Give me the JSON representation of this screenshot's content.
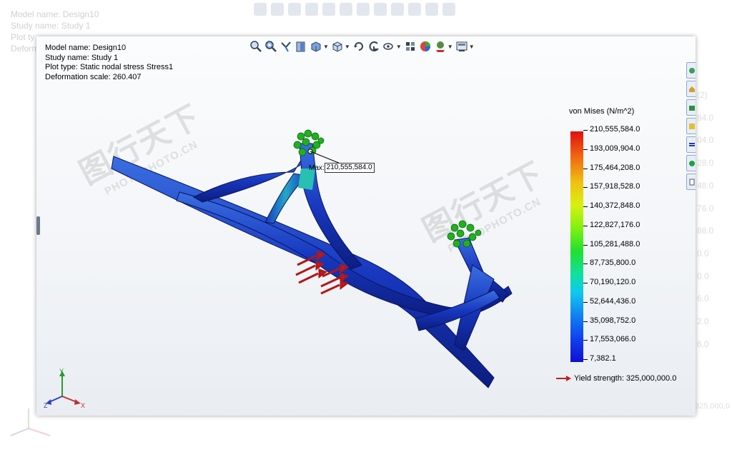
{
  "info": {
    "model_name": "Model name: Design10",
    "study_name": "Study name: Study 1",
    "plot_type": "Plot type: Static nodal stress Stress1",
    "deformation_scale": "Deformation scale: 260.407"
  },
  "ghost_info": {
    "model_name": "Model name: Design10",
    "study_name": "Study name: Study 1",
    "plot_type": "Plot ty",
    "deformation": "Deformi"
  },
  "ghost_scale": [
    "(2)",
    "84.0",
    "04.0",
    "28.0",
    "48.0",
    "76.0",
    "88.0",
    "0.0",
    "0.0",
    "6.0",
    "2.0",
    "6.0"
  ],
  "ghost_bottom": "325,000,0",
  "toolbar": {
    "icons": [
      "zoom-to-fit-icon",
      "zoom-to-area-icon",
      "previous-view-icon",
      "section-view-icon",
      "display-style-icon",
      "view-orientation-icon",
      "rotate-icon",
      "pan-icon",
      "hide-show-items-icon",
      "edit-appearance-icon",
      "apply-scene-icon",
      "view-settings-icon"
    ]
  },
  "legend": {
    "title": "von Mises (N/m^2)",
    "values": [
      "210,555,584.0",
      "193,009,904.0",
      "175,464,208.0",
      "157,918,528.0",
      "140,372,848.0",
      "122,827,176.0",
      "105,281,488.0",
      "87,735,800.0",
      "70,190,120.0",
      "52,644,436.0",
      "35,098,752.0",
      "17,553,066.0",
      "7,382.1"
    ],
    "yield": "Yield strength: 325,000,000.0",
    "colors": {
      "max": "#e01010",
      "mid": "#20e030",
      "min": "#1010d0"
    }
  },
  "max_label": {
    "prefix": "Max:",
    "value": "210,555,584.0"
  },
  "triad": {
    "x": "X",
    "y": "Y",
    "z": "Z"
  },
  "watermark": {
    "cn": "图行天下",
    "en": "PHOTOPHOTO.CN"
  },
  "sidebar": {
    "icons": [
      "solidworks-resources-icon",
      "design-library-icon",
      "file-explorer-icon",
      "view-palette-icon",
      "appearances-icon",
      "custom-properties-icon",
      "document-icon"
    ]
  }
}
